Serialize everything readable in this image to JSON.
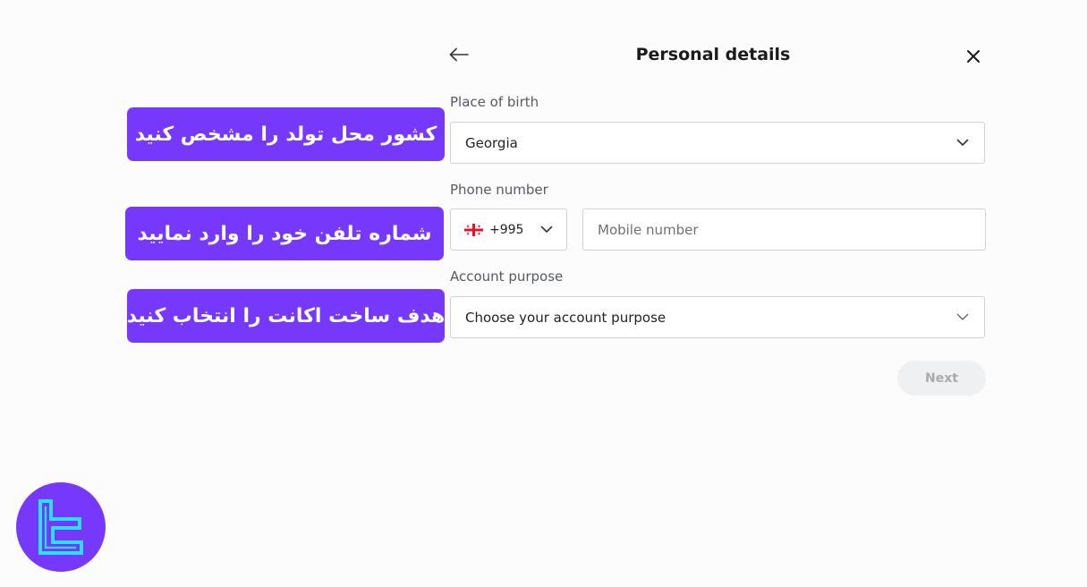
{
  "header": {
    "title": "Personal details",
    "back_icon": "arrow-left-icon",
    "close_icon": "close-icon"
  },
  "form": {
    "place_of_birth": {
      "label": "Place of birth",
      "value": "Georgia"
    },
    "phone": {
      "label": "Phone number",
      "country_code": "+995",
      "flag_icon": "georgia-flag-icon",
      "mobile_placeholder": "Mobile number"
    },
    "account_purpose": {
      "label": "Account purpose",
      "placeholder": "Choose your account purpose"
    },
    "next_label": "Next"
  },
  "annotations": [
    "کشور محل تولد را مشخص کنید",
    "شماره تلفن خود را وارد نمایید",
    "هدف ساخت اکانت را انتخاب کنید"
  ],
  "colors": {
    "accent": "#7638fa",
    "next_disabled_bg": "#eff0f1",
    "next_disabled_text": "#a8abae"
  }
}
